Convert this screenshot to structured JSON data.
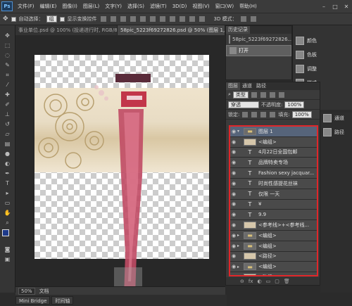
{
  "menu": {
    "logo": "Ps",
    "items": [
      "文件(F)",
      "编辑(E)",
      "图像(I)",
      "图层(L)",
      "文字(Y)",
      "选择(S)",
      "滤镜(T)",
      "3D(D)",
      "视图(V)",
      "窗口(W)",
      "帮助(H)"
    ]
  },
  "options": {
    "auto_select_label": "自动选择：",
    "auto_select_value": "组",
    "show_transform_label": "显示变换控件",
    "mode_3d": "3D 模式："
  },
  "tabs": [
    {
      "label": "事业单位.psd @ 100% (投递进行时, RGB/8#)",
      "active": false
    },
    {
      "label": "58pic_5223f69272826.psd @ 50% (图层 1, RGB/8)",
      "active": true
    }
  ],
  "status": {
    "zoom": "50%",
    "doc_label": "文档"
  },
  "bottom_tabs": [
    "Mini Bridge",
    "时间轴"
  ],
  "history": {
    "tab": "历史记录",
    "snapshot": "58pic_5223f69272826...",
    "action": "打开"
  },
  "dock": {
    "items": [
      "颜色",
      "色板",
      "调整",
      "样式",
      "图层",
      "通道",
      "路径"
    ]
  },
  "layers_panel": {
    "tabs": [
      "图层",
      "通道",
      "路径"
    ],
    "filter": "类型",
    "blend": "穿透",
    "opacity_label": "不透明度:",
    "opacity": "100%",
    "lock_label": "锁定:",
    "fill_label": "填充:",
    "fill": "100%",
    "layers": [
      {
        "name": "图层 1",
        "kind": "group",
        "expand": "▾"
      },
      {
        "name": "<编组>",
        "kind": "image",
        "expand": ""
      },
      {
        "name": "4月22日全国包邮",
        "kind": "text",
        "expand": ""
      },
      {
        "name": "品牌特卖专场",
        "kind": "text",
        "expand": ""
      },
      {
        "name": "Fashion sexy jacquar...",
        "kind": "text",
        "expand": ""
      },
      {
        "name": "时尚性感提花丝袜",
        "kind": "text",
        "expand": ""
      },
      {
        "name": "仅限 一天",
        "kind": "text",
        "expand": ""
      },
      {
        "name": "¥",
        "kind": "text",
        "expand": ""
      },
      {
        "name": "9.9",
        "kind": "text",
        "expand": ""
      },
      {
        "name": "<参考线>+<参考线...",
        "kind": "image",
        "expand": ""
      },
      {
        "name": "<编组>",
        "kind": "group",
        "expand": "▸"
      },
      {
        "name": "<编组>",
        "kind": "group",
        "expand": "▸"
      },
      {
        "name": "<路径>",
        "kind": "image",
        "expand": ""
      },
      {
        "name": "<编组>",
        "kind": "group",
        "expand": "▸"
      },
      {
        "name": "<路径>",
        "kind": "image",
        "expand": ""
      }
    ],
    "footer": [
      "⊖",
      "fx",
      "◐",
      "▭",
      "▢",
      "🗑"
    ]
  },
  "colors": {
    "foreground": "#1e3a8a",
    "background": "#d61f26",
    "highlight": "#e0262a"
  }
}
